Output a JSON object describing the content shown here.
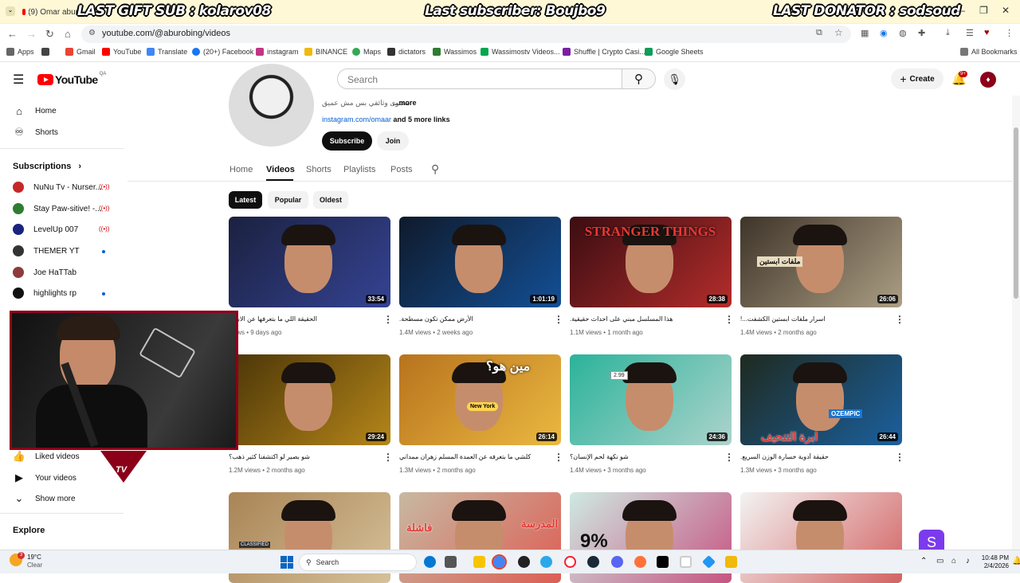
{
  "browser": {
    "tab_title": "(9) Omar abur",
    "url": "youtube.com/@aburobing/videos",
    "bookmarks": [
      "Apps",
      "Gmail",
      "YouTube",
      "Translate",
      "(20+) Facebook",
      "instagram",
      "BINANCE",
      "Maps",
      "dictators",
      "Wassimos",
      "Wassimostv Videos...",
      "Shuffle | Crypto Casi...",
      "Google Sheets",
      "All Bookmarks"
    ]
  },
  "overlay": {
    "gift": "LAST GIFT SUB : kolarov08",
    "subscriber": "Last subscriber: Boujbo9",
    "donator": "LAST DONATOR : sodsoud"
  },
  "header": {
    "logo": "YouTube",
    "logo_region": "QA",
    "search_placeholder": "Search",
    "create_label": "Create",
    "notif_count": "9+"
  },
  "sidebar": {
    "home": "Home",
    "shorts": "Shorts",
    "subscriptions_title": "Subscriptions",
    "subscriptions": [
      {
        "name": "NuNu Tv - Nurser...",
        "status": "live",
        "color": "#c62828"
      },
      {
        "name": "Stay Paw-sitive! -...",
        "status": "live",
        "color": "#2e7d32"
      },
      {
        "name": "LevelUp 007",
        "status": "live",
        "color": "#1a237e"
      },
      {
        "name": "THEMER YT",
        "status": "new",
        "color": "#333333"
      },
      {
        "name": "Joe HaTTab",
        "status": "none",
        "color": "#8d3b3b"
      },
      {
        "name": "highlights rp",
        "status": "new",
        "color": "#111111"
      }
    ],
    "liked": "Liked videos",
    "your_videos": "Your videos",
    "show_more": "Show more",
    "explore": "Explore"
  },
  "channel": {
    "description": "محتوى وثائقي بس مش عميق",
    "more": "...more",
    "link": "instagram.com/omaar",
    "more_links": "and 5 more links",
    "subscribe": "Subscribe",
    "join": "Join",
    "tabs": [
      "Home",
      "Videos",
      "Shorts",
      "Playlists",
      "Posts"
    ],
    "chips": [
      "Latest",
      "Popular",
      "Oldest"
    ]
  },
  "videos": [
    {
      "title": "الحقيقة اللي ما بتعرفها عن الابراج",
      "views": "views • 9 days ago",
      "duration": "33:54",
      "bg": "#1b2140",
      "accent": "#3f51b5"
    },
    {
      "title": "الأرض ممكن تكون مسطحة.",
      "views": "1.4M views • 2 weeks ago",
      "duration": "1:01:19",
      "bg": "#0f1a2b",
      "accent": "#1565c0"
    },
    {
      "title": "هذا المسلسل مبني على احداث حقيقية.",
      "views": "1.1M views • 1 month ago",
      "duration": "28:38",
      "bg": "#3a0d12",
      "accent": "#e53935"
    },
    {
      "title": "اسرار ملفات ابستين الكشفت...!",
      "views": "1.4M views • 2 months ago",
      "duration": "26:06",
      "bg": "#3e3429",
      "accent": "#d7c9a8"
    },
    {
      "title": "شو بصير لو اكتشفنا كثير ذهب؟",
      "views": "1.2M views • 2 months ago",
      "duration": "29:24",
      "bg": "#4a3508",
      "accent": "#e0a620"
    },
    {
      "title": "كلشي ما بتعرفه عن العمدة المسلم زهران ممداني",
      "views": "1.3M views • 2 months ago",
      "duration": "26:14",
      "bg": "#b8731d",
      "accent": "#ffd54f"
    },
    {
      "title": "شو نكهة لحم الإنسان؟",
      "views": "1.4M views • 3 months ago",
      "duration": "24:36",
      "bg": "#2bb39a",
      "accent": "#e0e0e0"
    },
    {
      "title": "حقيقة أدوية خسارة الوزن السريع.",
      "views": "1.3M views • 3 months ago",
      "duration": "26:44",
      "bg": "#1f2a1f",
      "accent": "#1976d2"
    },
    {
      "title": "",
      "views": "",
      "duration": "",
      "bg": "#a98455",
      "accent": "#e8d9b5"
    },
    {
      "title": "",
      "views": "",
      "duration": "",
      "bg": "#c7b9a2",
      "accent": "#e53935"
    },
    {
      "title": "",
      "views": "",
      "duration": "",
      "bg": "#cfe9e2",
      "accent": "#c2185b"
    },
    {
      "title": "",
      "views": "",
      "duration": "",
      "bg": "#f3f3f3",
      "accent": "#c62828"
    }
  ],
  "thumb_text": {
    "stranger": "STRANGER THINGS",
    "epstein": "ملفات ابستين",
    "who": "مين هو؟",
    "ny": "New York",
    "price": "2.99",
    "ozempic": "OZEMPIC",
    "needle": "ابرة التنحيف",
    "classified": "CLASSIFIED",
    "school": "المدرسة",
    "fail": "فاشلة",
    "pct": "9%"
  },
  "weather": {
    "temp": "19°C",
    "cond": "Clear",
    "badge": "3"
  },
  "taskbar": {
    "search": "Search",
    "time": "10:48 PM",
    "date": "2/4/2026"
  },
  "webcam_label": "TV"
}
